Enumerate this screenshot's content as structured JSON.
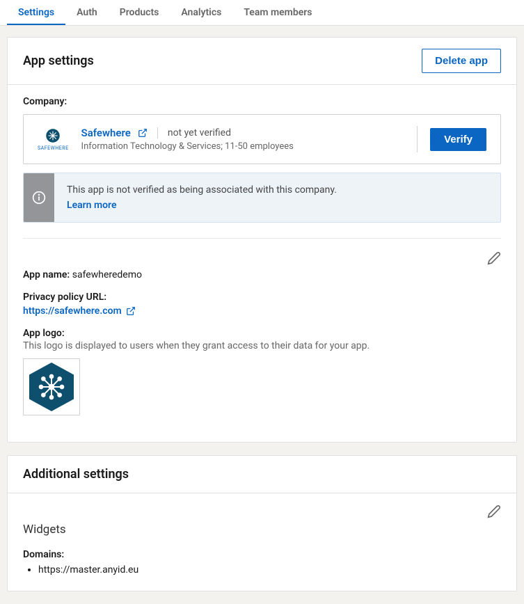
{
  "tabs": {
    "settings": "Settings",
    "auth": "Auth",
    "products": "Products",
    "analytics": "Analytics",
    "team": "Team members"
  },
  "appSettings": {
    "title": "App settings",
    "deleteLabel": "Delete app",
    "companyLabel": "Company:",
    "company": {
      "name": "Safewhere",
      "logoCaption": "SAFEWHERE",
      "status": "not yet verified",
      "subtitle": "Information Technology & Services; 11-50 employees",
      "verifyLabel": "Verify"
    },
    "banner": {
      "text": "This app is not verified as being associated with this company.",
      "learnMore": "Learn more"
    },
    "appNameLabel": "App name:",
    "appName": "safewheredemo",
    "privacyLabel": "Privacy policy URL:",
    "privacyUrl": "https://safewhere.com",
    "logoLabel": "App logo:",
    "logoDesc": "This logo is displayed to users when they grant access to their data for your app."
  },
  "additional": {
    "title": "Additional settings",
    "widgetsTitle": "Widgets",
    "domainsLabel": "Domains:",
    "domains": [
      "https://master.anyid.eu"
    ]
  }
}
